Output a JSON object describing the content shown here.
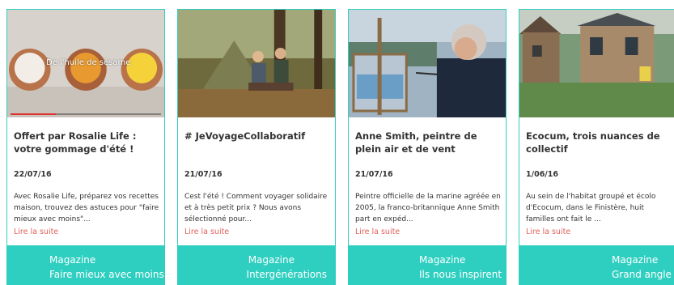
{
  "cards": [
    {
      "video_caption": "De l'huile de sésame",
      "video_progress_percent": 30,
      "title": "Offert par Rosalie Life : votre gommage d'été !",
      "date": "22/07/16",
      "excerpt": "Avec Rosalie Life, préparez vos recettes maison, trouvez des astuces pour \"faire mieux avec moins\"...",
      "read_more": "Lire la suite",
      "category": "Magazine",
      "subcategory": "Faire mieux avec moins"
    },
    {
      "title": "# JeVoyageCollaboratif",
      "date": "21/07/16",
      "excerpt": "Cest l'été ! Comment voyager solidaire et à très petit prix ? Nous avons sélectionné pour...",
      "read_more": "Lire la suite",
      "category": "Magazine",
      "subcategory": "Intergénérations"
    },
    {
      "title": "Anne Smith, peintre de plein air et de vent",
      "date": "21/07/16",
      "excerpt": "Peintre officielle de la marine agréée en 2005, la franco-britannique Anne Smith part en expéd...",
      "read_more": "Lire la suite",
      "category": "Magazine",
      "subcategory": "Ils nous inspirent"
    },
    {
      "title": "Ecocum, trois nuances de collectif",
      "date": "1/06/16",
      "excerpt": "Au sein de l'habitat groupé et écolo d'Ecocum, dans le Finistère, huit familles ont fait le ...",
      "read_more": "Lire la suite",
      "category": "Magazine",
      "subcategory": "Grand angle"
    }
  ],
  "colors": {
    "accent": "#2ecfc0",
    "read_more": "#e0605a",
    "text": "#333333"
  }
}
